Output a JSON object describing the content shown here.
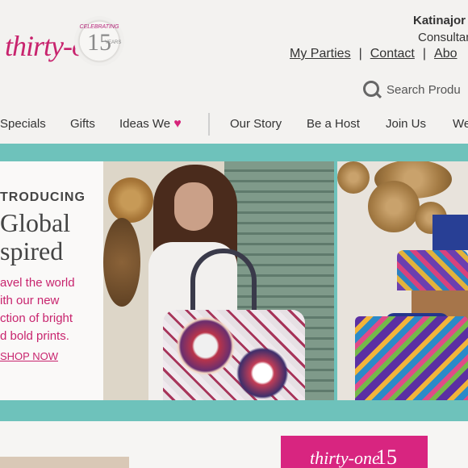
{
  "brand": {
    "logo_text": "thirty-one",
    "badge_top": "CELEBRATING",
    "badge_number": "15",
    "badge_years": "YEARS"
  },
  "account": {
    "name": "Katinajor",
    "role": "Consultan",
    "links": [
      "My Parties",
      "Contact",
      "Abo"
    ],
    "separators": [
      "|",
      "|"
    ]
  },
  "search": {
    "placeholder": "Search Produ"
  },
  "nav": {
    "items": [
      "Specials",
      "Gifts",
      "Ideas We",
      "Our Story",
      "Be a Host",
      "Join Us",
      "We"
    ],
    "heart": "♥"
  },
  "hero": {
    "intro": "TRODUCING",
    "title_line1": "Global",
    "title_line2": "spired",
    "copy_lines": [
      "avel the world",
      "ith our new",
      "ction of bright",
      "d bold prints."
    ],
    "cta": "SHOP NOW"
  },
  "promo": {
    "logo_text": "thirty-one",
    "number": "15"
  },
  "colors": {
    "brand_pink": "#c8246e",
    "teal_band": "#6ec2bb",
    "promo_pink": "#d82580"
  },
  "icons": [
    "search-icon",
    "heart-icon"
  ]
}
